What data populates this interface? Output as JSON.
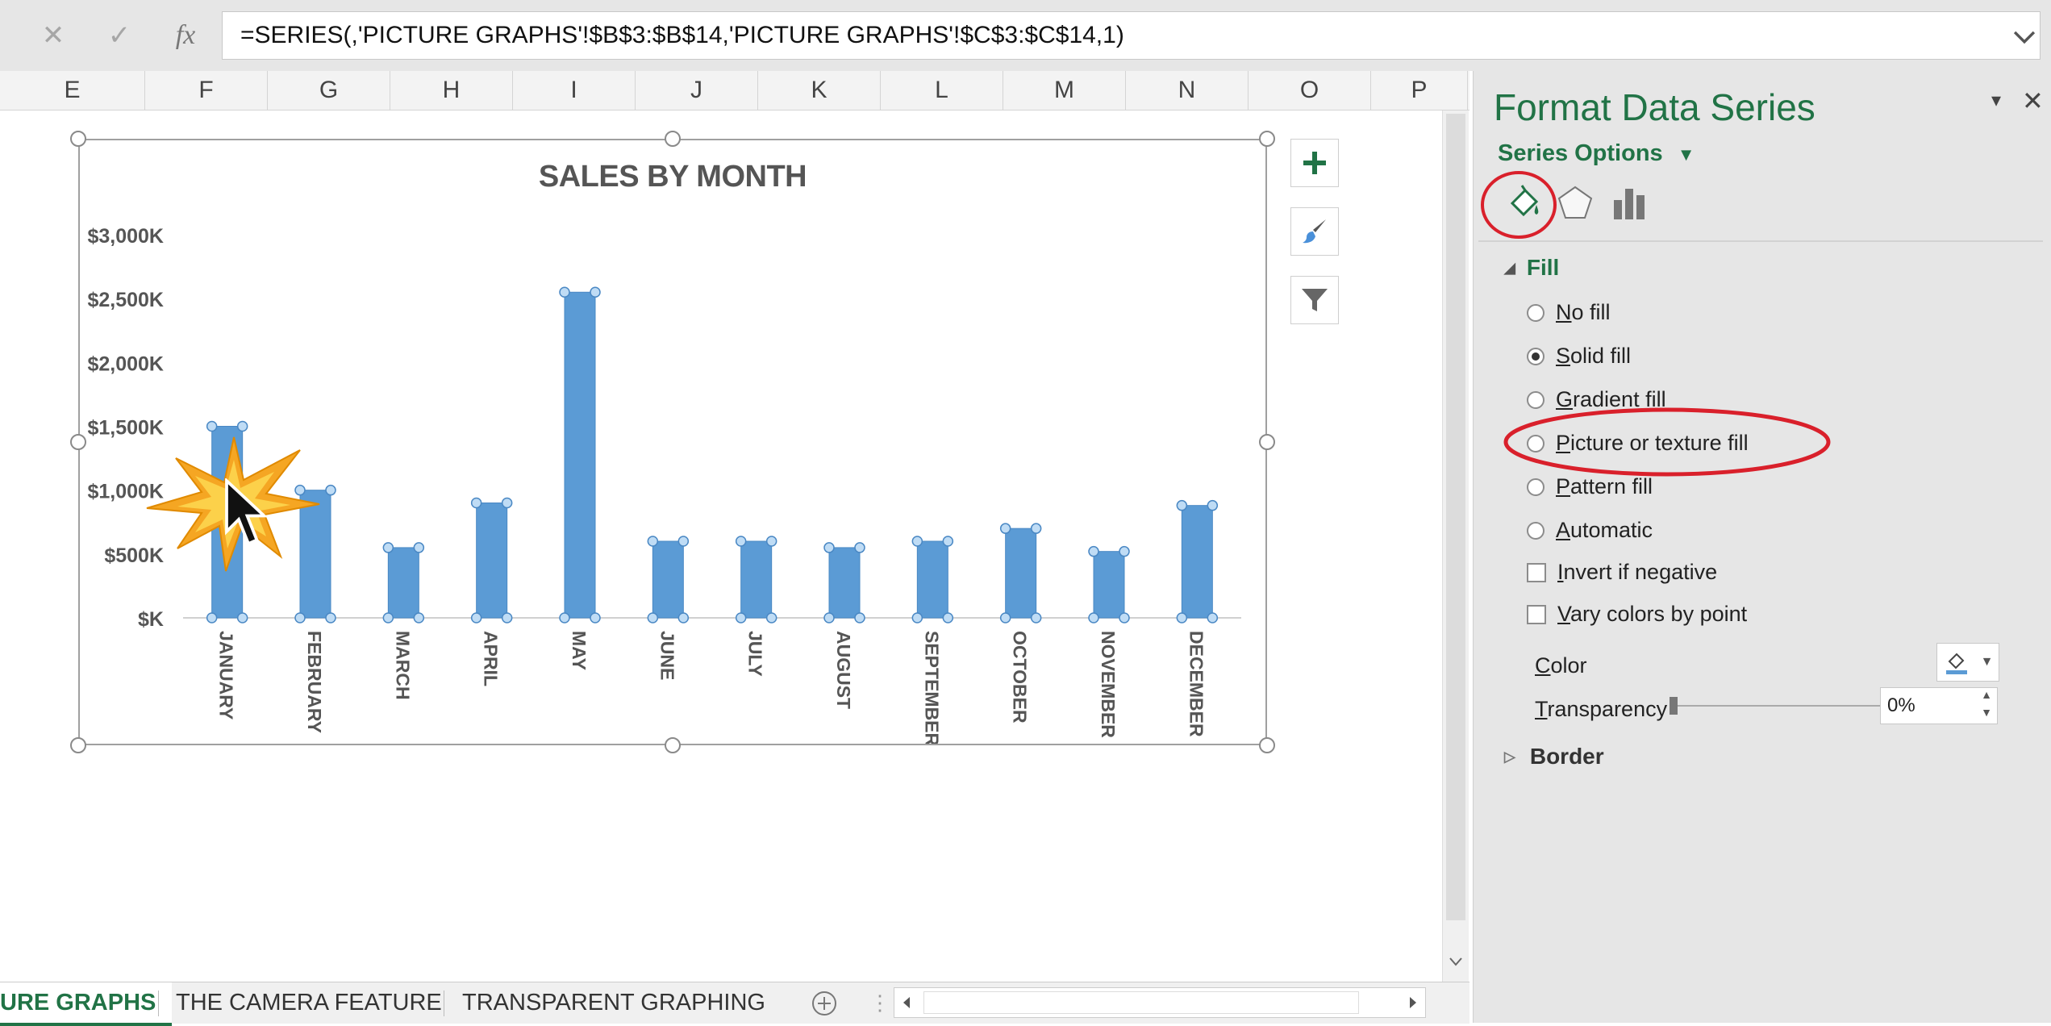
{
  "formula_bar": {
    "cancel_icon": "close-x",
    "enter_icon": "checkmark",
    "fx_label": "fx",
    "formula": "=SERIES(,'PICTURE GRAPHS'!$B$3:$B$14,'PICTURE GRAPHS'!$C$3:$C$14,1)"
  },
  "column_headers": [
    "E",
    "F",
    "G",
    "H",
    "I",
    "J",
    "K",
    "L",
    "M",
    "N",
    "O",
    "P"
  ],
  "chart_data": {
    "type": "bar",
    "title": "SALES BY MONTH",
    "categories": [
      "JANUARY",
      "FEBRUARY",
      "MARCH",
      "APRIL",
      "MAY",
      "JUNE",
      "JULY",
      "AUGUST",
      "SEPTEMBER",
      "OCTOBER",
      "NOVEMBER",
      "DECEMBER"
    ],
    "series": [
      {
        "values": [
          1500,
          1000,
          550,
          900,
          2550,
          600,
          600,
          550,
          600,
          700,
          520,
          880
        ]
      }
    ],
    "y_tick_labels": [
      "$K",
      "$500K",
      "$1,000K",
      "$1,500K",
      "$2,000K",
      "$2,500K",
      "$3,000K"
    ],
    "ylim": [
      0,
      3000
    ],
    "xlabel": "",
    "ylabel": "",
    "bar_color": "#5b9bd5",
    "grid": false,
    "legend": "none"
  },
  "chart_buttons": {
    "elements_icon": "plus-icon",
    "styles_icon": "brush-icon",
    "filter_icon": "filter-icon"
  },
  "sheet_tabs": {
    "active": "URE GRAPHS",
    "tabs": [
      "THE CAMERA FEATURE",
      "TRANSPARENT GRAPHING"
    ]
  },
  "pane": {
    "title": "Format Data Series",
    "series_options": "Series Options",
    "fill_section": "Fill",
    "fill_options": [
      "No fill",
      "Solid fill",
      "Gradient fill",
      "Picture or texture fill",
      "Pattern fill",
      "Automatic"
    ],
    "selected_fill": "Solid fill",
    "checkboxes": [
      "Invert if negative",
      "Vary colors by point"
    ],
    "color_label": "Color",
    "transparency_label": "Transparency",
    "transparency_value": "0%",
    "border_section": "Border"
  },
  "colors": {
    "accent_green": "#217346",
    "annotation_red": "#d9202b",
    "bar_blue": "#5b9bd5"
  }
}
